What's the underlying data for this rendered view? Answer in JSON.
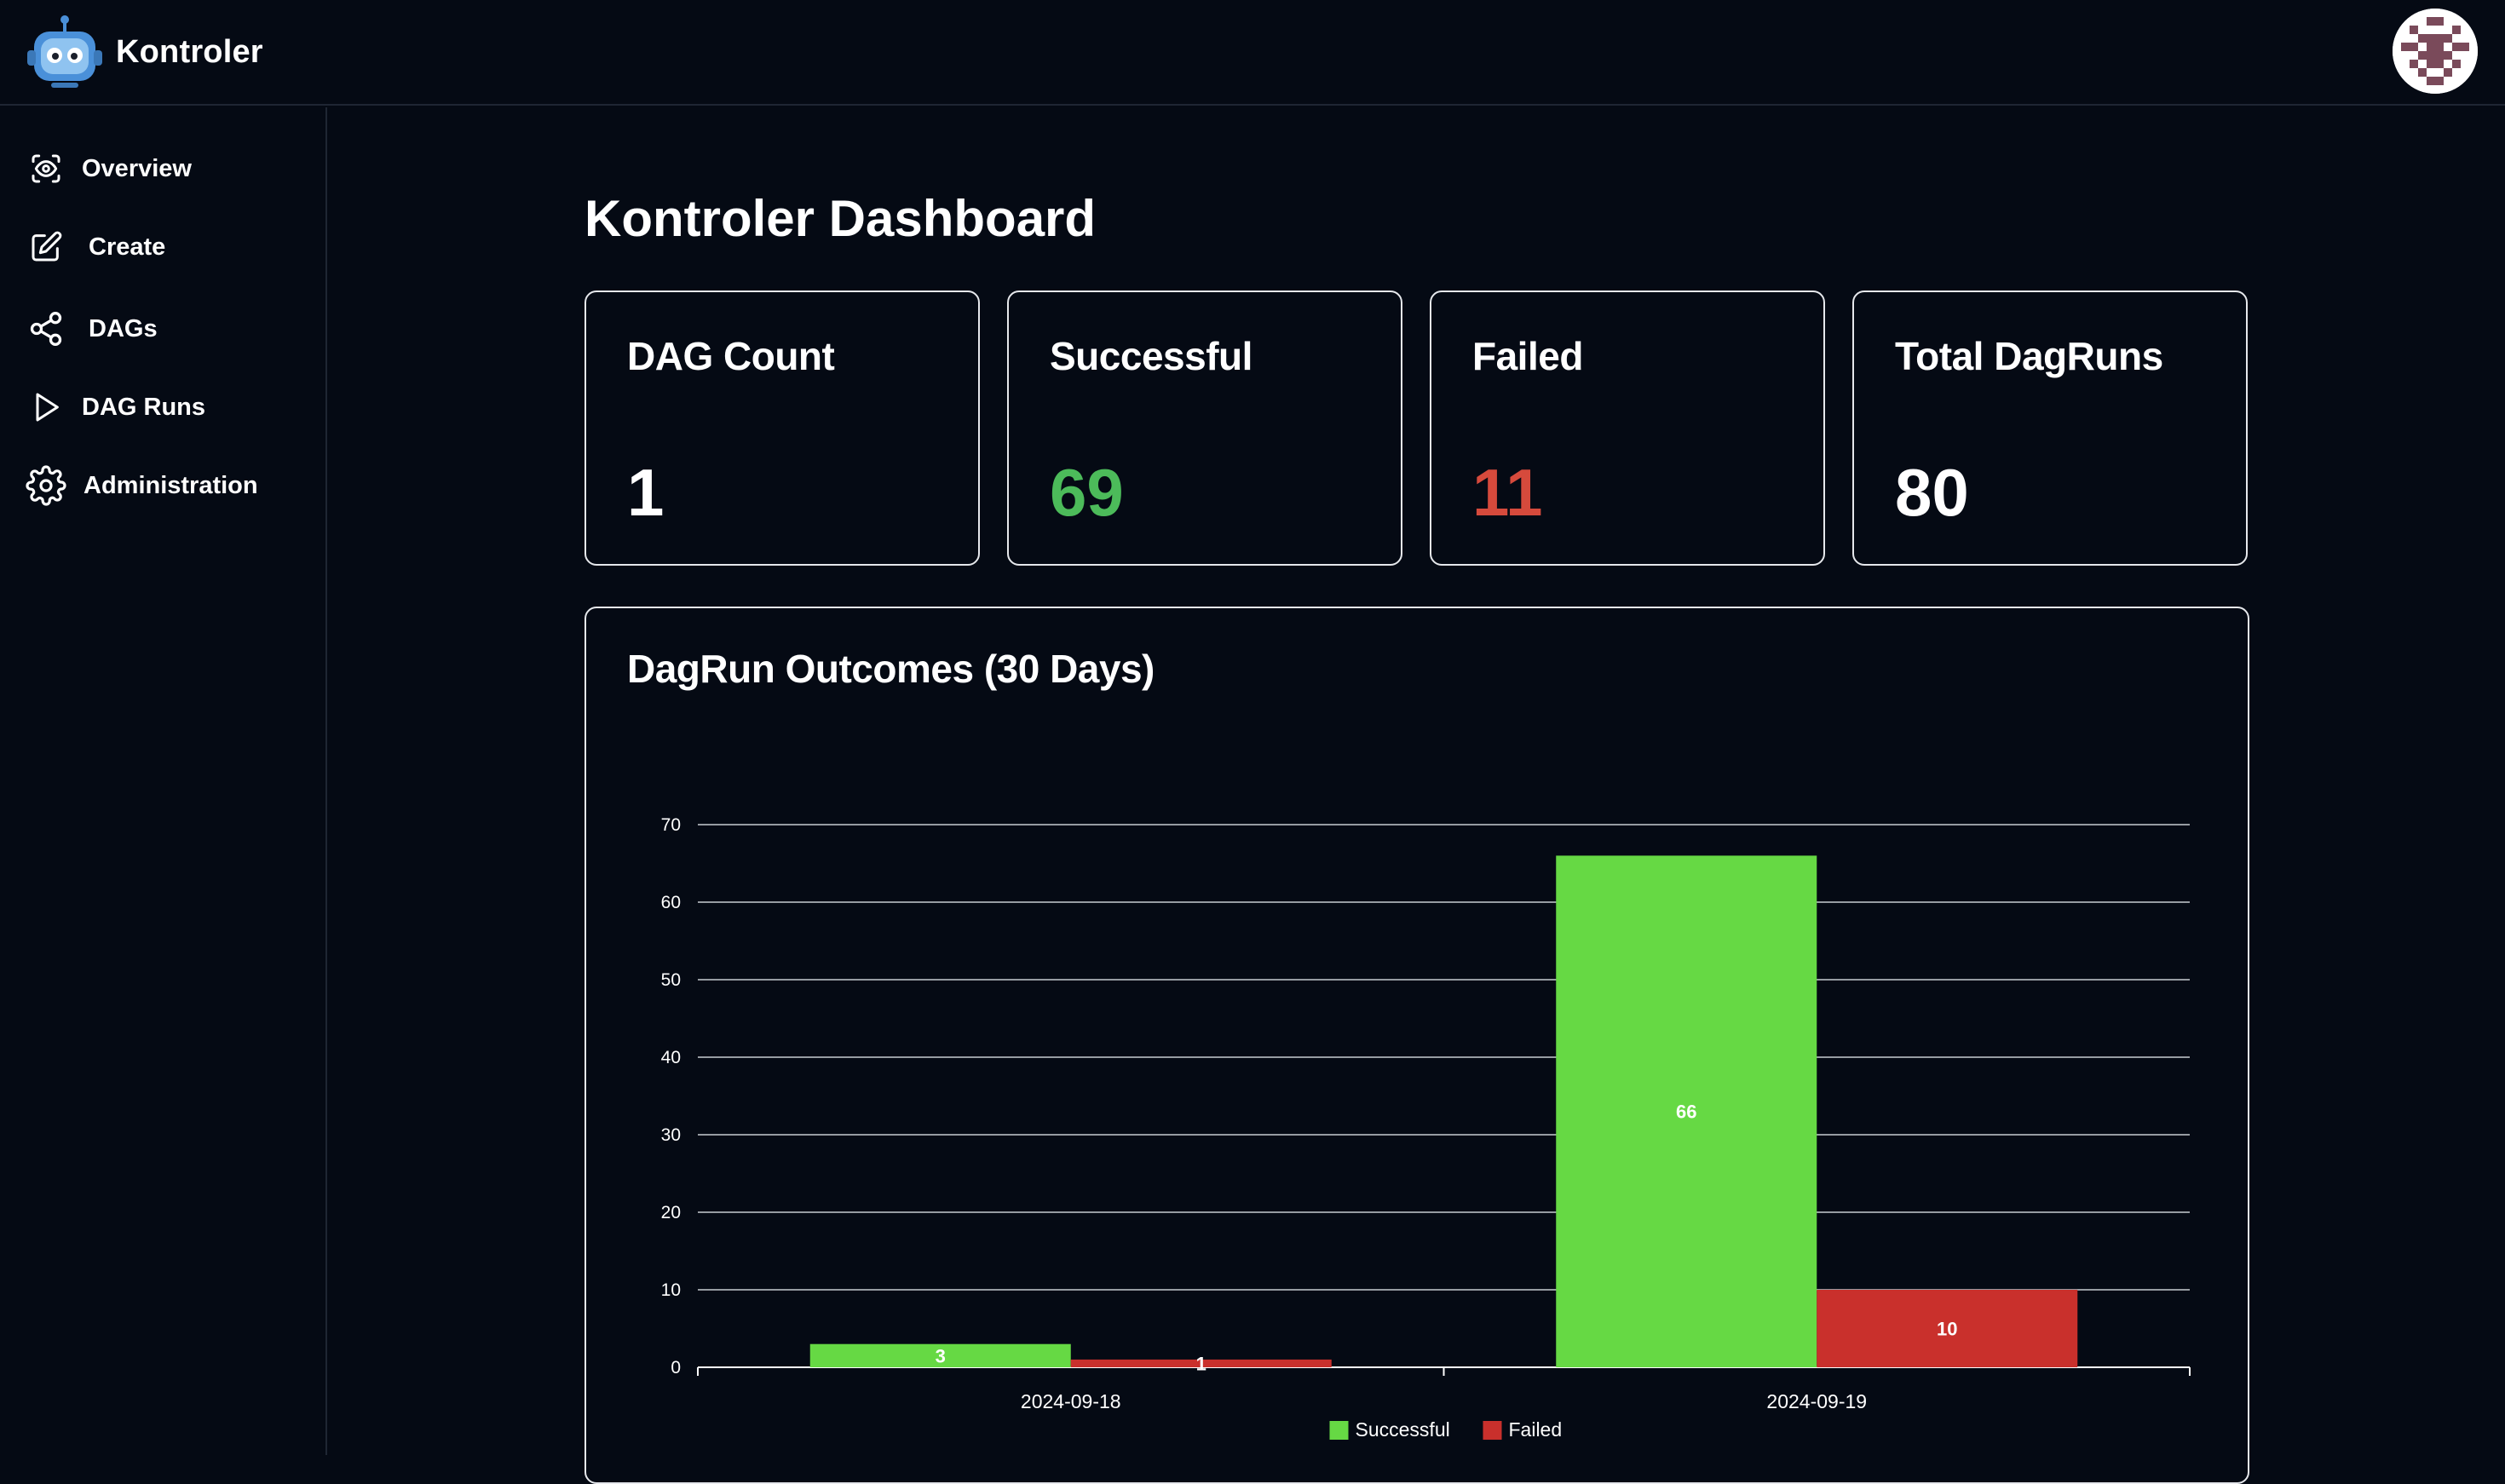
{
  "app": {
    "name": "Kontroler"
  },
  "sidebar": {
    "items": [
      {
        "label": "Overview",
        "icon": "eye-icon"
      },
      {
        "label": "Create",
        "icon": "edit-icon"
      },
      {
        "label": "DAGs",
        "icon": "share-icon"
      },
      {
        "label": "DAG Runs",
        "icon": "play-icon"
      },
      {
        "label": "Administration",
        "icon": "gear-icon"
      }
    ]
  },
  "main": {
    "title": "Kontroler Dashboard",
    "stats": [
      {
        "label": "DAG Count",
        "value": "1",
        "color": "#ffffff"
      },
      {
        "label": "Successful",
        "value": "69",
        "color": "#4cbb5a"
      },
      {
        "label": "Failed",
        "value": "11",
        "color": "#d64a3c"
      },
      {
        "label": "Total DagRuns",
        "value": "80",
        "color": "#ffffff"
      }
    ]
  },
  "chart_data": {
    "type": "bar",
    "title": "DagRun Outcomes (30 Days)",
    "categories": [
      "2024-09-18",
      "2024-09-19"
    ],
    "series": [
      {
        "name": "Successful",
        "values": [
          3,
          66
        ],
        "color": "#66d944"
      },
      {
        "name": "Failed",
        "values": [
          1,
          10
        ],
        "color": "#c9302c"
      }
    ],
    "ylim": [
      0,
      70
    ],
    "yticks": [
      "0",
      "10",
      "20",
      "30",
      "40",
      "50",
      "60",
      "70"
    ],
    "grid": true,
    "legend": "bottom"
  }
}
